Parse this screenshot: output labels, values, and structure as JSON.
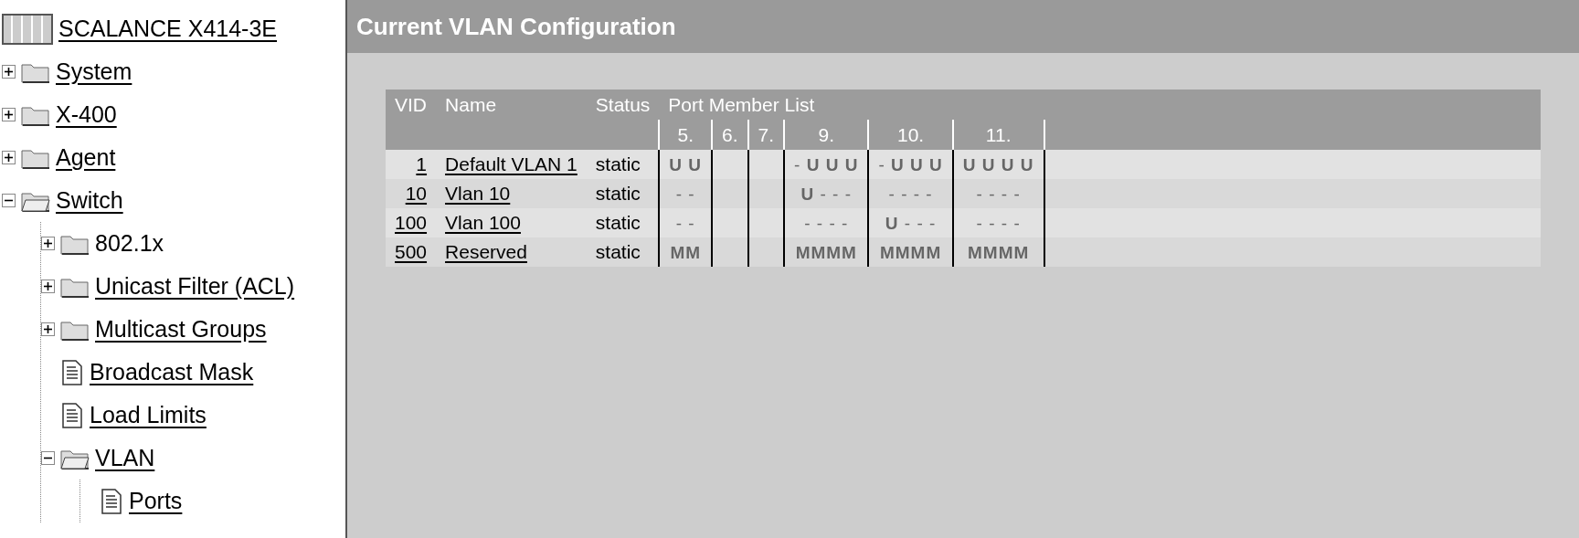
{
  "sidebar": {
    "root": {
      "label": "SCALANCE X414-3E"
    },
    "tree": [
      {
        "label": "System",
        "kind": "folder",
        "expanded": false,
        "link": true
      },
      {
        "label": "X-400",
        "kind": "folder",
        "expanded": false,
        "link": true
      },
      {
        "label": "Agent",
        "kind": "folder",
        "expanded": false,
        "link": true
      },
      {
        "label": "Switch",
        "kind": "folder",
        "expanded": true,
        "link": true,
        "children": [
          {
            "label": "802.1x",
            "kind": "folder",
            "expanded": false,
            "link": false
          },
          {
            "label": "Unicast Filter (ACL)",
            "kind": "folder",
            "expanded": false,
            "link": true
          },
          {
            "label": "Multicast Groups",
            "kind": "folder",
            "expanded": false,
            "link": true
          },
          {
            "label": "Broadcast Mask",
            "kind": "page",
            "link": true
          },
          {
            "label": "Load Limits",
            "kind": "page",
            "link": true
          },
          {
            "label": "VLAN",
            "kind": "folder",
            "expanded": true,
            "link": true,
            "children": [
              {
                "label": "Ports",
                "kind": "page",
                "link": true
              }
            ]
          }
        ]
      }
    ]
  },
  "page_title": "Current VLAN Configuration",
  "table": {
    "columns": [
      "VID",
      "Name",
      "Status"
    ],
    "port_group": "Port Member List",
    "ports": [
      "5.",
      "6.",
      "7.",
      "9.",
      "10.",
      "11."
    ],
    "rows": [
      {
        "vid": "1",
        "name": "Default VLAN 1",
        "status": "static",
        "port_col_1": "**U U**",
        "port_col_4": "- **U U U**",
        "port_col_5": "- **U U U**",
        "port_col_6": "**U U U U**"
      },
      {
        "vid": "10",
        "name": "Vlan 10",
        "status": "static",
        "port_col_1": "- -",
        "port_col_4": "**U** - - -",
        "port_col_5": "- - - -",
        "port_col_6": "- - - -"
      },
      {
        "vid": "100",
        "name": "Vlan 100",
        "status": "static",
        "port_col_1": "- -",
        "port_col_4": "- - - -",
        "port_col_5": "**U** - - -",
        "port_col_6": "- - - -"
      },
      {
        "vid": "500",
        "name": "Reserved",
        "status": "static",
        "port_col_1": "**MM**",
        "port_col_4": "**MMMM**",
        "port_col_5": "**MMMM**",
        "port_col_6": "**MMMM**"
      }
    ]
  }
}
